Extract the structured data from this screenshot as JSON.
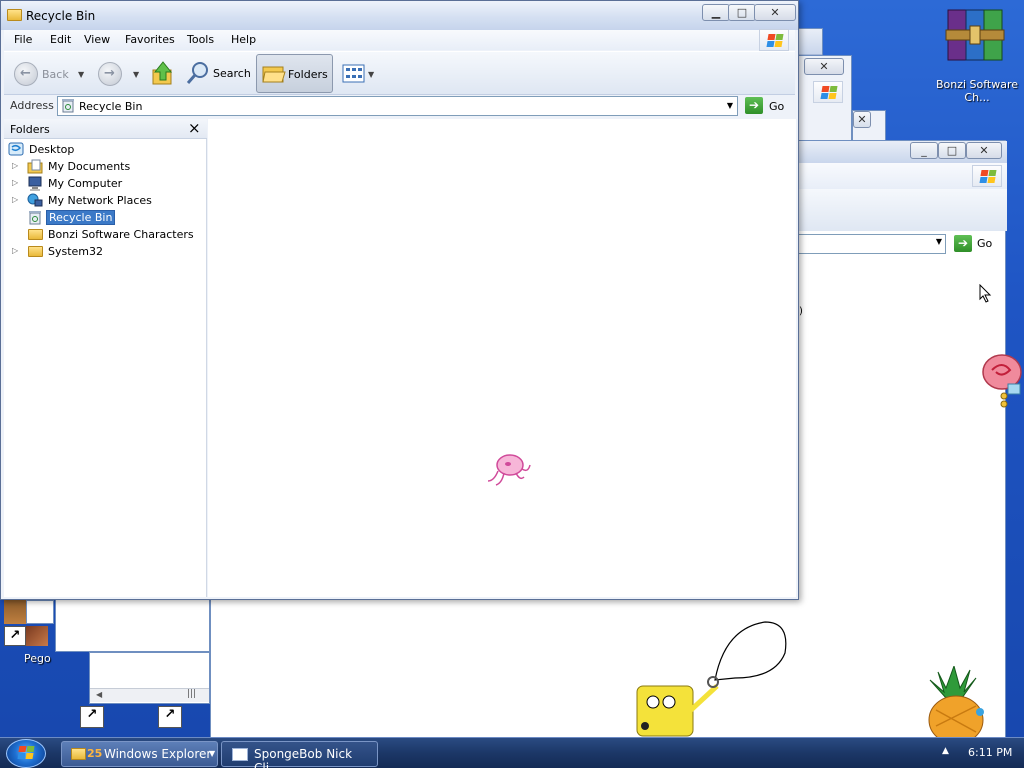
{
  "main_window": {
    "title": "Recycle Bin",
    "menu": [
      "File",
      "Edit",
      "View",
      "Favorites",
      "Tools",
      "Help"
    ],
    "toolbar": {
      "back_label": "Back",
      "search_label": "Search",
      "folders_label": "Folders"
    },
    "address": {
      "label": "Address",
      "value": "Recycle Bin",
      "go_label": "Go"
    },
    "folders_pane": {
      "title": "Folders",
      "close_glyph": "×",
      "tree": [
        {
          "label": "Desktop"
        },
        {
          "label": "My Documents"
        },
        {
          "label": "My Computer"
        },
        {
          "label": "My Network Places"
        },
        {
          "label": "Recycle Bin"
        },
        {
          "label": "Bonzi Software Characters"
        },
        {
          "label": "System32"
        }
      ]
    }
  },
  "background_window": {
    "go_label": "Go",
    "partial_text": ")"
  },
  "desktop": {
    "icons": [
      {
        "label": "Bonzi Software Ch..."
      },
      {
        "label": "Pego"
      }
    ]
  },
  "taskbar": {
    "buttons": [
      {
        "count": "25",
        "label": "Windows Explorer"
      },
      {
        "label": "SpongeBob Nick Cli..."
      }
    ],
    "clock": "6:11 PM",
    "tray_glyph": "▲"
  },
  "colors": {
    "desktop_blue": "#1f55c4",
    "selection": "#3b79c7",
    "go_green": "#2f8f28"
  }
}
